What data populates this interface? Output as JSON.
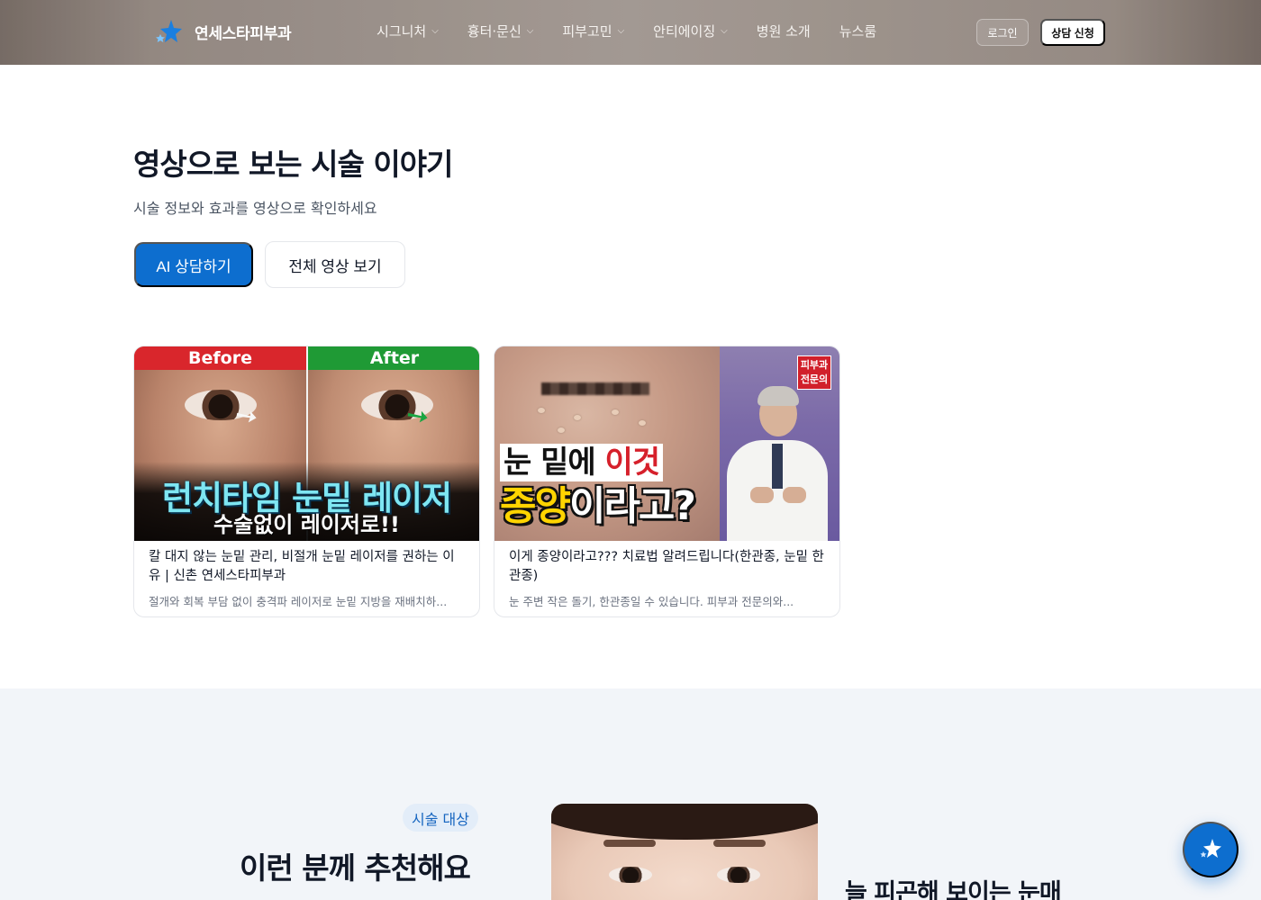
{
  "header": {
    "logo_text": "연세스타피부과",
    "nav": [
      {
        "label": "시그니처",
        "has_dropdown": true
      },
      {
        "label": "흉터·문신",
        "has_dropdown": true
      },
      {
        "label": "피부고민",
        "has_dropdown": true
      },
      {
        "label": "안티에이징",
        "has_dropdown": true
      },
      {
        "label": "병원 소개",
        "has_dropdown": false
      },
      {
        "label": "뉴스룸",
        "has_dropdown": false
      }
    ],
    "login_label": "로그인",
    "consult_label": "상담 신청"
  },
  "video_section": {
    "title": "영상으로 보는 시술 이야기",
    "subtitle": "시술 정보와 효과를 영상으로 확인하세요",
    "ai_button": "AI 상담하기",
    "all_button": "전체 영상 보기",
    "cards": [
      {
        "thumb": {
          "before": "Before",
          "after": "After",
          "headline": "런치타임 눈밑 레이저",
          "subline": "수술없이 레이저로!!"
        },
        "title": "칼 대지 않는 눈밑 관리, 비절개 눈밑 레이저를 권하는 이유 | 신촌 연세스타피부과",
        "desc": "절개와 회복 부담 없이 충격파 레이저로 눈밑 지방을 재배치하..."
      },
      {
        "thumb": {
          "badge_line1": "피부과",
          "badge_line2": "전문의",
          "line1_a": "눈 밑에 ",
          "line1_b": "이것",
          "line2_a": "종양",
          "line2_b": "이라고?"
        },
        "title": "이게 종양이라고??? 치료법 알려드립니다(한관종, 눈밑 한관종)",
        "desc": "눈 주변 작은 돌기, 한관종일 수 있습니다. 피부과 전문의와..."
      }
    ]
  },
  "recommend_section": {
    "tag": "시술 대상",
    "title": "이런 분께 추천해요",
    "side_text": "늘 피곤해 보이는 눈매"
  },
  "colors": {
    "primary": "#0d6ecf",
    "before_red": "#d9262c",
    "after_green": "#1f9a35",
    "section_bg": "#f2f5f9"
  },
  "icons": {
    "logo": "star-logo-icon",
    "chevron": "chevron-down-icon",
    "fab": "sparkle-icon"
  }
}
